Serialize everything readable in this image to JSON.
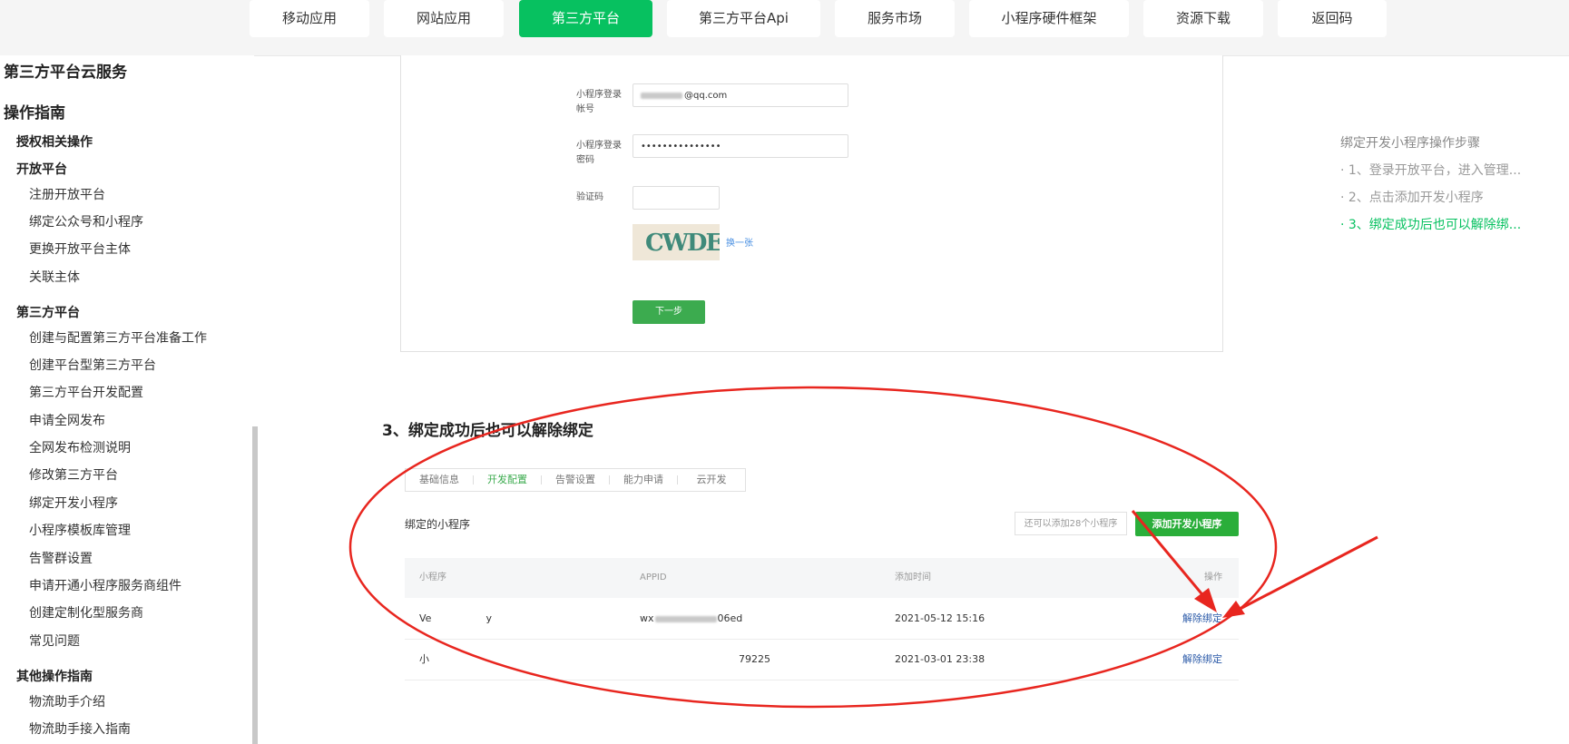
{
  "nav": {
    "items": [
      {
        "label": "移动应用"
      },
      {
        "label": "网站应用"
      },
      {
        "label": "第三方平台",
        "active": true
      },
      {
        "label": "第三方平台Api"
      },
      {
        "label": "服务市场"
      },
      {
        "label": "小程序硬件框架"
      },
      {
        "label": "资源下载"
      },
      {
        "label": "返回码"
      }
    ]
  },
  "sidebar": {
    "cloud_title": "第三方平台云服务",
    "guide_title": "操作指南",
    "auth_ops": "授权相关操作",
    "open_platform": {
      "title": "开放平台",
      "items": [
        "注册开放平台",
        "绑定公众号和小程序",
        "更换开放平台主体",
        "关联主体"
      ]
    },
    "third_party": {
      "title": "第三方平台",
      "items": [
        "创建与配置第三方平台准备工作",
        "创建平台型第三方平台",
        "第三方平台开发配置",
        "申请全网发布",
        "全网发布检测说明",
        "修改第三方平台",
        "绑定开发小程序",
        "小程序模板库管理",
        "告警群设置",
        "申请开通小程序服务商组件",
        "创建定制化型服务商",
        "常见问题"
      ]
    },
    "other": {
      "title": "其他操作指南",
      "items": [
        "物流助手介绍",
        "物流助手接入指南"
      ]
    }
  },
  "form": {
    "account_label": "小程序登录帐号",
    "account_value": "@qq.com",
    "password_label": "小程序登录密码",
    "password_value": "•••••••••••••••",
    "captcha_label": "验证码",
    "captcha_text": "CWDE",
    "refresh_link": "换一张",
    "next_button": "下一步"
  },
  "toc": {
    "title": "绑定开发小程序操作步骤",
    "items": [
      {
        "label": "· 1、登录开放平台，进入管理..."
      },
      {
        "label": "· 2、点击添加开发小程序"
      },
      {
        "label": "· 3、绑定成功后也可以解除绑...",
        "active": true
      }
    ]
  },
  "section": {
    "title": "3、绑定成功后也可以解除绑定",
    "tabs": [
      "基础信息",
      "开发配置",
      "告警设置",
      "能力申请",
      "云开发"
    ],
    "active_tab": 1,
    "bound_label": "绑定的小程序",
    "remaining_placeholder": "还可以添加28个小程序",
    "add_button": "添加开发小程序",
    "table": {
      "headers": [
        "小程序",
        "APPID",
        "添加时间",
        "操作"
      ],
      "rows": [
        {
          "name_start": "Ve",
          "name_end": "y",
          "appid_start": "wx",
          "appid_end": "06ed",
          "time": "2021-05-12 15:16",
          "action": "解除绑定"
        },
        {
          "name_start": "小",
          "name_end": "",
          "appid_start": "",
          "appid_end": "79225",
          "time": "2021-03-01 23:38",
          "action": "解除绑定"
        }
      ]
    }
  },
  "colors": {
    "accent": "#07c160",
    "annotation": "#e8261f",
    "link": "#2b5aa8"
  }
}
